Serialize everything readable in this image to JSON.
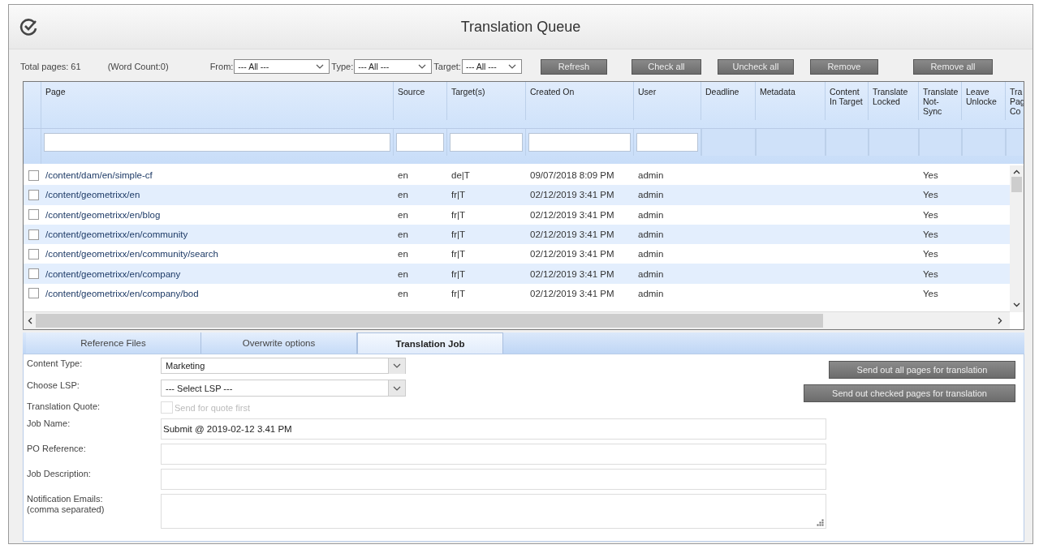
{
  "window": {
    "title": "Translation Queue"
  },
  "toolbar": {
    "total_pages": "Total pages: 61",
    "word_count": "(Word Count:0)",
    "filters": [
      {
        "label": "From:",
        "value": "--- All ---"
      },
      {
        "label": "Type:",
        "value": "--- All ---"
      },
      {
        "label": "Target:",
        "value": "--- All ---"
      }
    ],
    "buttons": [
      "Refresh",
      "Check all",
      "Uncheck all",
      "Remove",
      "Remove all"
    ]
  },
  "table": {
    "columns": [
      {
        "label": "Page",
        "filter": true
      },
      {
        "label": "Source",
        "filter": true
      },
      {
        "label": "Target(s)",
        "filter": true
      },
      {
        "label": "Created On",
        "filter": true
      },
      {
        "label": "User",
        "filter": true
      },
      {
        "label": "Deadline",
        "filter": false
      },
      {
        "label": "Metadata",
        "filter": false
      },
      {
        "label": "Content In Target",
        "filter": false
      },
      {
        "label": "Translate Locked",
        "filter": false
      },
      {
        "label": "Translate Not-Sync",
        "filter": false
      },
      {
        "label": "Leave Unlocke",
        "filter": false
      },
      {
        "label": "Tra Pag Co",
        "filter": false
      }
    ],
    "rows": [
      {
        "checked": false,
        "page": "/content/dam/en/simple-cf",
        "source": "en",
        "targets": "de|T",
        "created_on": "09/07/2018 8:09 PM",
        "user": "admin",
        "translate_not_sync": "Yes"
      },
      {
        "checked": false,
        "page": "/content/geometrixx/en",
        "source": "en",
        "targets": "fr|T",
        "created_on": "02/12/2019 3:41 PM",
        "user": "admin",
        "translate_not_sync": "Yes"
      },
      {
        "checked": false,
        "page": "/content/geometrixx/en/blog",
        "source": "en",
        "targets": "fr|T",
        "created_on": "02/12/2019 3:41 PM",
        "user": "admin",
        "translate_not_sync": "Yes"
      },
      {
        "checked": false,
        "page": "/content/geometrixx/en/community",
        "source": "en",
        "targets": "fr|T",
        "created_on": "02/12/2019 3:41 PM",
        "user": "admin",
        "translate_not_sync": "Yes"
      },
      {
        "checked": false,
        "page": "/content/geometrixx/en/community/search",
        "source": "en",
        "targets": "fr|T",
        "created_on": "02/12/2019 3:41 PM",
        "user": "admin",
        "translate_not_sync": "Yes"
      },
      {
        "checked": false,
        "page": "/content/geometrixx/en/company",
        "source": "en",
        "targets": "fr|T",
        "created_on": "02/12/2019 3:41 PM",
        "user": "admin",
        "translate_not_sync": "Yes"
      },
      {
        "checked": false,
        "page": "/content/geometrixx/en/company/bod",
        "source": "en",
        "targets": "fr|T",
        "created_on": "02/12/2019 3:41 PM",
        "user": "admin",
        "translate_not_sync": "Yes"
      }
    ]
  },
  "tabs": [
    {
      "label": "Reference Files",
      "selected": false
    },
    {
      "label": "Overwrite options",
      "selected": false
    },
    {
      "label": "Translation Job",
      "selected": true
    }
  ],
  "job_form": {
    "fields": [
      {
        "kind": "select",
        "label": "Content Type:",
        "value": "Marketing"
      },
      {
        "kind": "select",
        "label": "Choose LSP:",
        "value": "--- Select LSP ---"
      },
      {
        "kind": "checkbox",
        "label": "Translation Quote:",
        "option": "Send for quote first",
        "checked": false,
        "disabled": true
      },
      {
        "kind": "text",
        "label": "Job Name:",
        "value": "Submit @ 2019-02-12 3.41 PM"
      },
      {
        "kind": "text",
        "label": "PO Reference:"
      },
      {
        "kind": "text",
        "label": "Job Description:"
      },
      {
        "kind": "textarea",
        "label": "Notification Emails: (comma separated)"
      }
    ],
    "actions": [
      "Send out all pages for translation",
      "Send out checked pages for translation"
    ]
  }
}
